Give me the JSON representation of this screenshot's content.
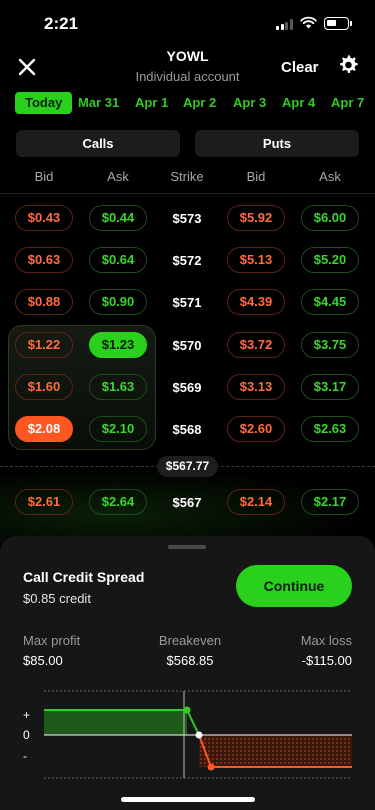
{
  "status": {
    "time": "2:21"
  },
  "header": {
    "title": "YOWL",
    "subtitle": "Individual account",
    "clear_label": "Clear"
  },
  "dates": [
    "Today",
    "Mar 31",
    "Apr 1",
    "Apr 2",
    "Apr 3",
    "Apr 4",
    "Apr 7"
  ],
  "side_tabs": {
    "calls": "Calls",
    "puts": "Puts"
  },
  "columns": {
    "bid": "Bid",
    "ask": "Ask",
    "strike": "Strike"
  },
  "chain": [
    {
      "call_bid": "$0.43",
      "call_ask": "$0.44",
      "strike": "$573",
      "put_bid": "$5.92",
      "put_ask": "$6.00"
    },
    {
      "call_bid": "$0.63",
      "call_ask": "$0.64",
      "strike": "$572",
      "put_bid": "$5.13",
      "put_ask": "$5.20"
    },
    {
      "call_bid": "$0.88",
      "call_ask": "$0.90",
      "strike": "$571",
      "put_bid": "$4.39",
      "put_ask": "$4.45"
    },
    {
      "call_bid": "$1.22",
      "call_ask": "$1.23",
      "strike": "$570",
      "put_bid": "$3.72",
      "put_ask": "$3.75",
      "selected": "call_ask"
    },
    {
      "call_bid": "$1.60",
      "call_ask": "$1.63",
      "strike": "$569",
      "put_bid": "$3.13",
      "put_ask": "$3.17"
    },
    {
      "call_bid": "$2.08",
      "call_ask": "$2.10",
      "strike": "$568",
      "put_bid": "$2.60",
      "put_ask": "$2.63",
      "selected": "call_bid"
    },
    {
      "call_bid": "$2.61",
      "call_ask": "$2.64",
      "strike": "$567",
      "put_bid": "$2.14",
      "put_ask": "$2.17"
    }
  ],
  "current_price": "$567.77",
  "sheet": {
    "strategy": "Call Credit Spread",
    "credit": "$0.85 credit",
    "continue_label": "Continue",
    "stats": [
      {
        "label": "Max profit",
        "value": "$85.00"
      },
      {
        "label": "Breakeven",
        "value": "$568.85"
      },
      {
        "label": "Max loss",
        "value": "-$115.00"
      }
    ]
  },
  "pl_chart": {
    "y_labels": [
      "+",
      "0",
      "-"
    ],
    "max_profit": 85,
    "max_loss": -115,
    "breakeven": 568.85,
    "short_strike": 568,
    "long_strike": 570
  },
  "colors": {
    "green": "#2ad11c",
    "red": "#ff5722",
    "background": "#000000"
  }
}
